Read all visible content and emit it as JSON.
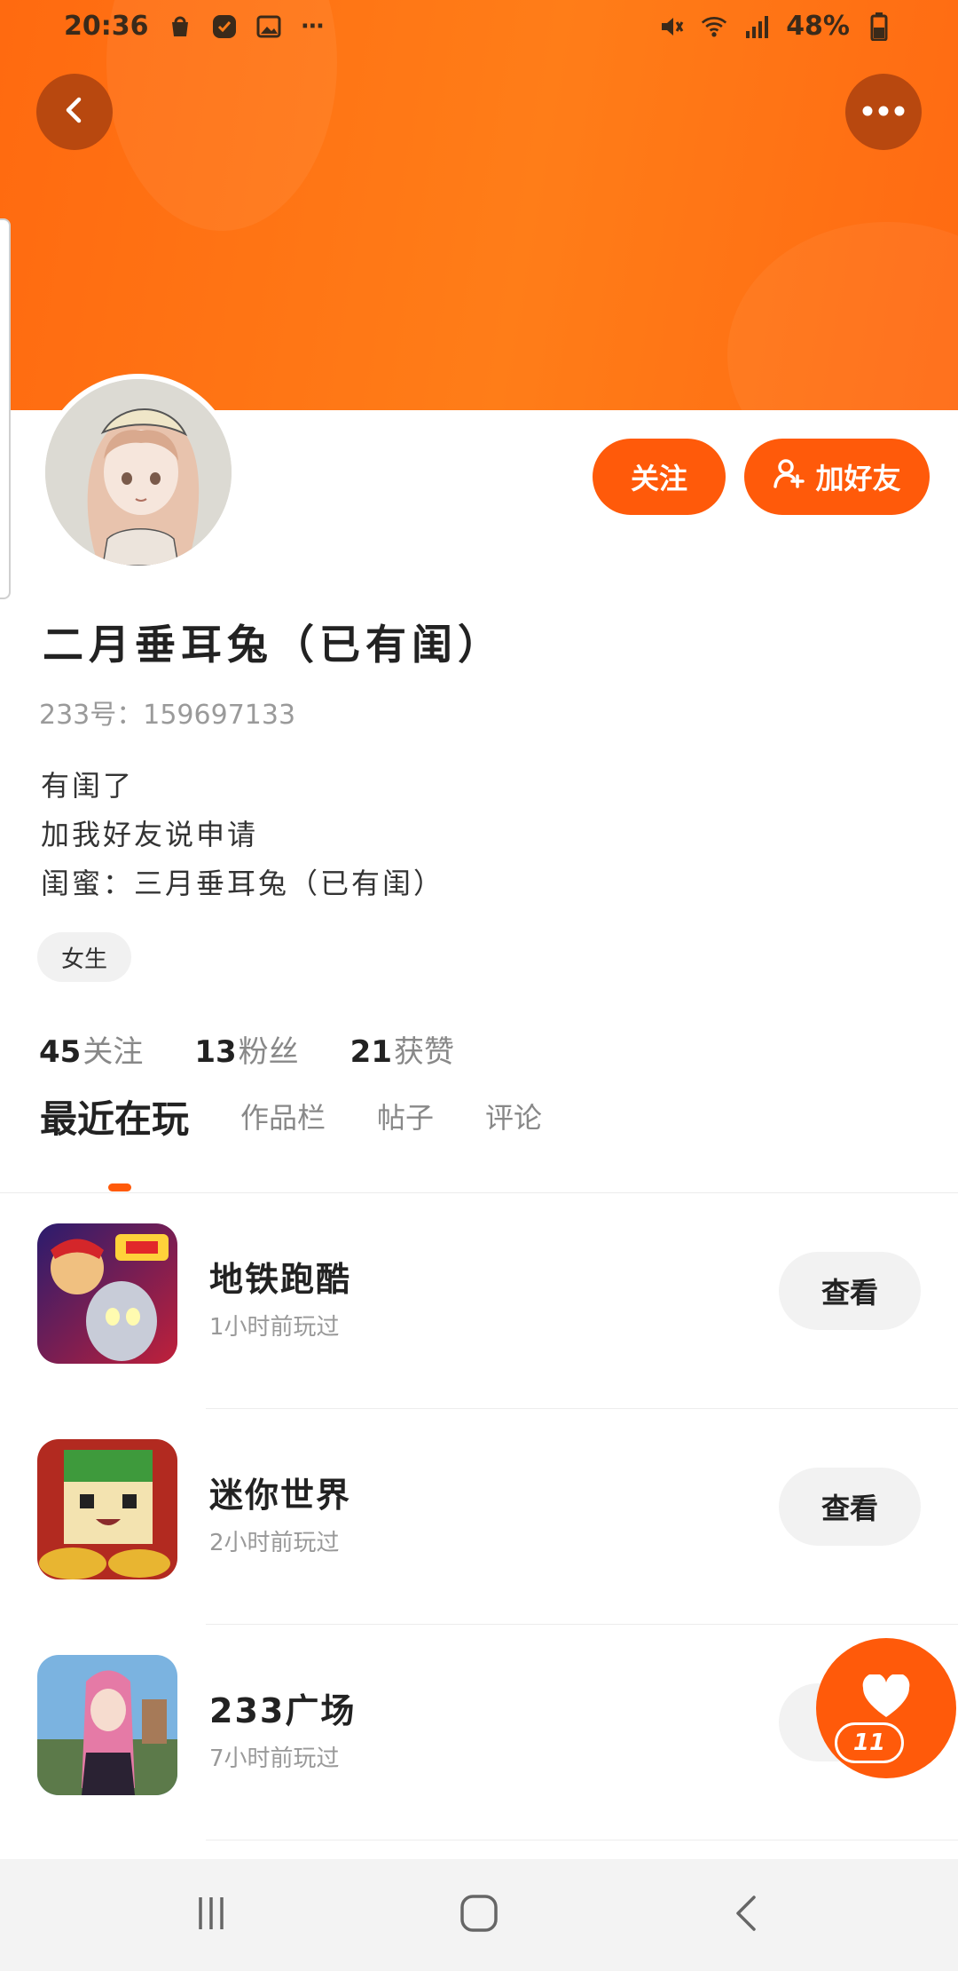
{
  "status_bar": {
    "time": "20:36",
    "battery": "48%",
    "left_icons": [
      "shopping-bag-icon",
      "app-icon",
      "gallery-icon",
      "more-dots-icon"
    ],
    "right_icons": [
      "mute-icon",
      "wifi-icon",
      "signal-icon",
      "battery-icon"
    ]
  },
  "header": {
    "back_icon": "chevron-left-icon",
    "more_icon": "more-horizontal-icon",
    "banner_color": "#ff6f14"
  },
  "profile": {
    "name": "二月垂耳兔（已有闺）",
    "id_line": "233号：159697133",
    "bio_lines": [
      "有闺了",
      "加我好友说申请",
      "闺蜜：三月垂耳兔（已有闺）"
    ],
    "tag": "女生",
    "follow_label": "关注",
    "add_friend_label": "加好友",
    "stats": [
      {
        "num": "45",
        "label": "关注"
      },
      {
        "num": "13",
        "label": "粉丝"
      },
      {
        "num": "21",
        "label": "获赞"
      }
    ]
  },
  "tabs": [
    {
      "label": "最近在玩",
      "active": true
    },
    {
      "label": "作品栏",
      "active": false
    },
    {
      "label": "帖子",
      "active": false
    },
    {
      "label": "评论",
      "active": false
    }
  ],
  "games": [
    {
      "title": "地铁跑酷",
      "subtitle": "1小时前玩过",
      "button": "查看"
    },
    {
      "title": "迷你世界",
      "subtitle": "2小时前玩过",
      "button": "查看"
    },
    {
      "title": "233广场",
      "subtitle": "7小时前玩过",
      "button": "查看"
    }
  ],
  "fab": {
    "icon": "heart-icon",
    "badge": "11"
  },
  "accent": "#ff5a0a",
  "nav_bar": {
    "icons": [
      "recent-apps-icon",
      "home-icon",
      "back-icon"
    ]
  }
}
